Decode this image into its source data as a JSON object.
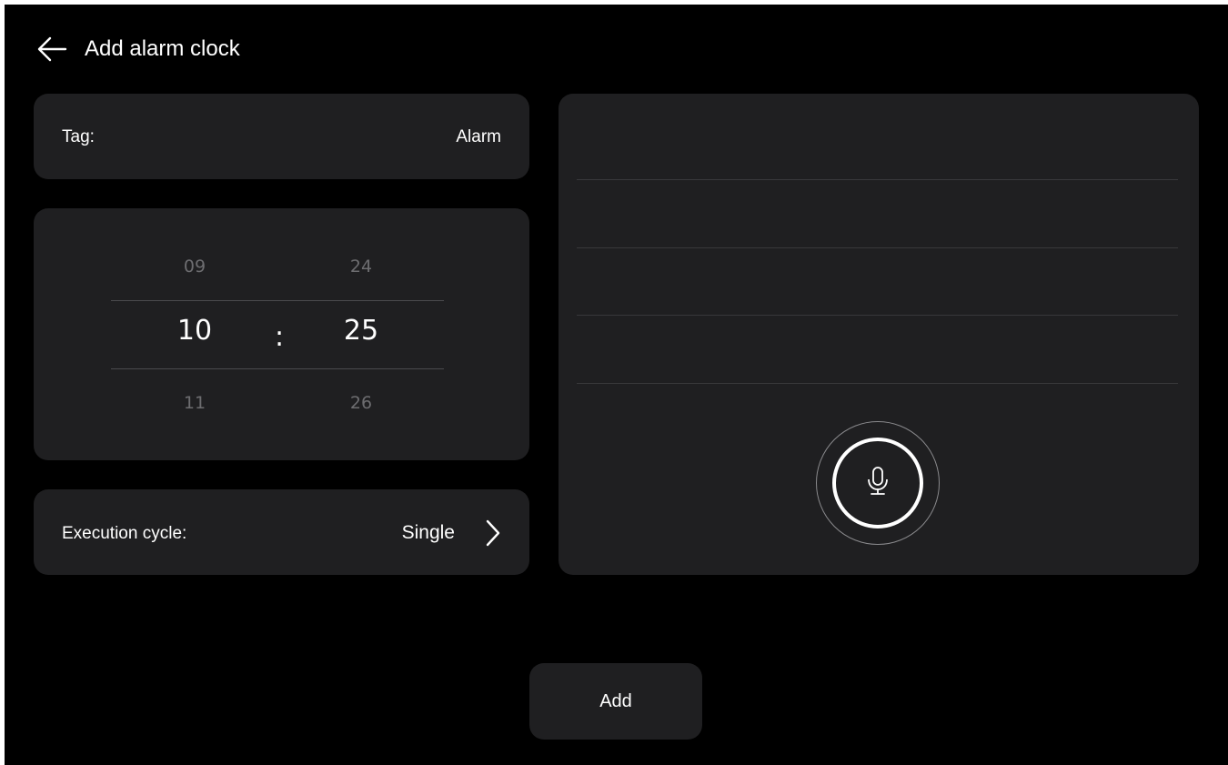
{
  "header": {
    "title": "Add alarm clock",
    "back_icon": "arrow-left-icon"
  },
  "tag": {
    "label": "Tag:",
    "value": "Alarm"
  },
  "time_picker": {
    "hours": {
      "prev": "09",
      "selected": "10",
      "next": "11"
    },
    "minutes": {
      "prev": "24",
      "selected": "25",
      "next": "26"
    },
    "separator": ":"
  },
  "execution_cycle": {
    "label": "Execution cycle:",
    "value": "Single",
    "icon": "chevron-right-icon"
  },
  "voice": {
    "icon": "microphone-icon"
  },
  "actions": {
    "add_label": "Add"
  }
}
